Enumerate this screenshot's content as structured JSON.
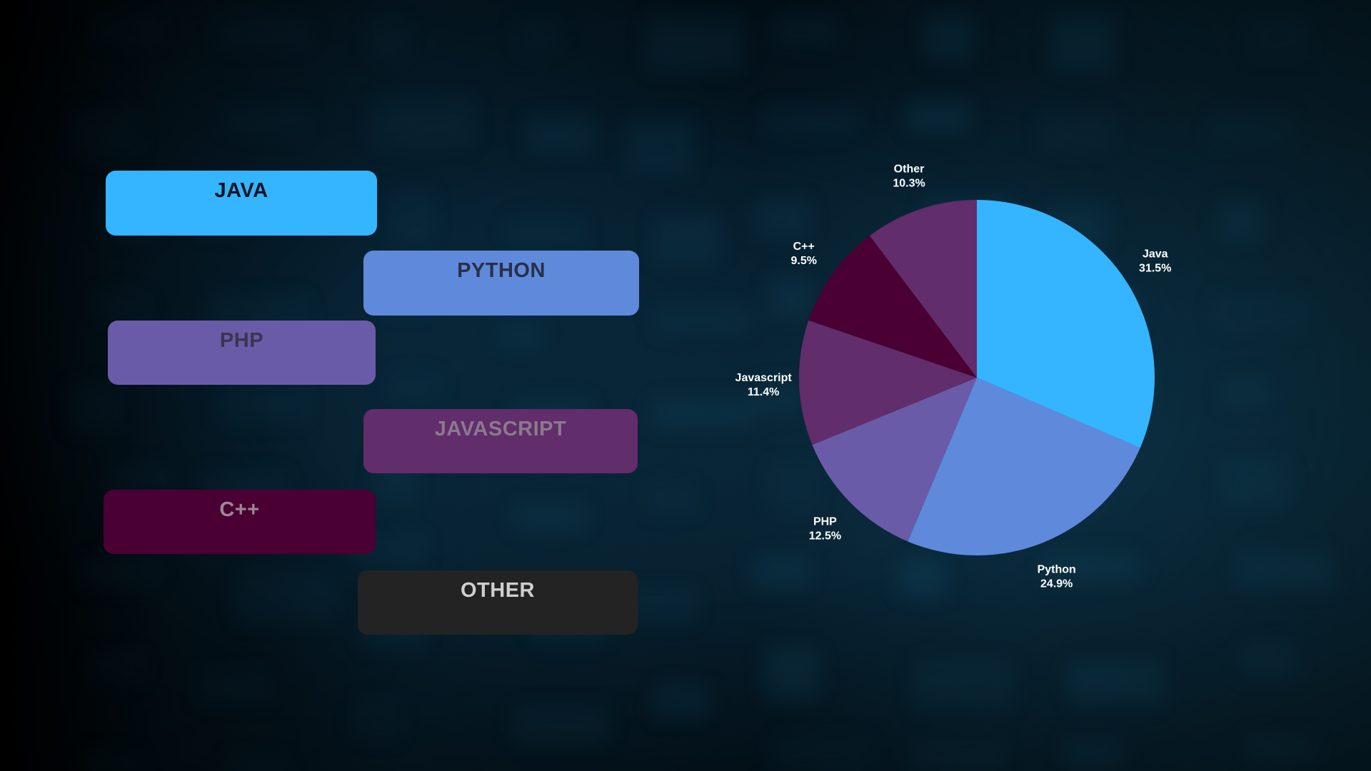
{
  "boxes": [
    {
      "label": "JAVA",
      "bg": "#35b5ff",
      "fg": "#0c1420"
    },
    {
      "label": "PYTHON",
      "bg": "#5f8adb",
      "fg": "#2a2f45"
    },
    {
      "label": "PHP",
      "bg": "#6a5ba8",
      "fg": "#3b3550"
    },
    {
      "label": "JAVASCRIPT",
      "bg": "#612d6b",
      "fg": "#8a7a8e"
    },
    {
      "label": "C++",
      "bg": "#4a0033",
      "fg": "#9a8a95"
    },
    {
      "label": "OTHER",
      "bg": "#232323",
      "fg": "#cfcfcf"
    }
  ],
  "chart_data": {
    "type": "pie",
    "title": "",
    "slices": [
      {
        "name": "Java",
        "value": 31.5,
        "label": "31.5%",
        "color": "#35b5ff"
      },
      {
        "name": "Python",
        "value": 24.9,
        "label": "24.9%",
        "color": "#5f8adb"
      },
      {
        "name": "PHP",
        "value": 12.5,
        "label": "12.5%",
        "color": "#6a5ba8"
      },
      {
        "name": "Javascript",
        "value": 11.4,
        "label": "11.4%",
        "color": "#612d6b"
      },
      {
        "name": "C++",
        "value": 9.5,
        "label": "9.5%",
        "color": "#4a0033"
      },
      {
        "name": "Other",
        "value": 10.3,
        "label": "10.3%",
        "color": "#612d6b"
      }
    ],
    "start": "12 o'clock",
    "direction": "clockwise",
    "legend": "none"
  }
}
